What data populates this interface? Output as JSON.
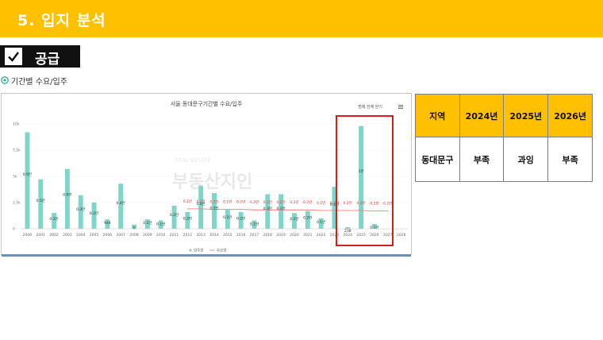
{
  "header": {
    "title": "5. 입지 분석",
    "accent": "#ffc000"
  },
  "section": {
    "label": "공급",
    "icon": "checkmark-icon"
  },
  "subheading": {
    "icon": "chart-circle-icon",
    "text": "기간별 수요/입주"
  },
  "chart_data": {
    "type": "bar",
    "title": "서울 동대문구기간별 수요/입주",
    "menu_label": "범례 전체 닫기",
    "watermark": "부동산지인",
    "categories": [
      "2000",
      "2001",
      "2002",
      "2003",
      "2004",
      "2005",
      "2006",
      "2007",
      "2008",
      "2009",
      "2010",
      "2011",
      "2012",
      "2013",
      "2014",
      "2015",
      "2016",
      "2017",
      "2018",
      "2019",
      "2020",
      "2021",
      "2022",
      "2023",
      "2024",
      "2025",
      "2026",
      "2027",
      "2028"
    ],
    "ylim": [
      0,
      10000
    ],
    "yticks": [
      "0",
      "2.5k",
      "5k",
      "7.5k",
      "10k"
    ],
    "bar_color": "#7dd6c8",
    "line_color": "#f28080",
    "series": [
      {
        "name": "입주량",
        "values": [
          9200,
          4700,
          1500,
          5700,
          3200,
          2500,
          900,
          4300,
          400,
          900,
          800,
          2200,
          1600,
          4100,
          3400,
          1800,
          1600,
          800,
          3300,
          3300,
          1500,
          1700,
          1000,
          4000,
          150,
          9800,
          450,
          0,
          0
        ],
        "labels": [
          "0.9만",
          "0.5만",
          "0.2만",
          "0.6만",
          "0.3만",
          "0.2만",
          "944",
          "0.4만",
          "0",
          "0.1만",
          "0.1만",
          "0.2만",
          "0.2만",
          "0.4만",
          "0.3만",
          "0.2만",
          "0.2만",
          "0.1만",
          "0.3만",
          "0.3만",
          "0.2만",
          "0.2만",
          "0.1만",
          "0.4만",
          "238",
          "1만",
          "0.1만",
          "",
          ""
        ]
      },
      {
        "name": "수요량",
        "values": [
          null,
          null,
          null,
          null,
          null,
          null,
          null,
          null,
          null,
          null,
          null,
          null,
          1900,
          1900,
          1850,
          1850,
          1850,
          1800,
          1800,
          1800,
          1800,
          1800,
          1750,
          1750,
          1750,
          1750,
          1700,
          1700,
          null
        ],
        "labels": [
          "",
          "",
          "",
          "",
          "",
          "",
          "",
          "",
          "",
          "",
          "",
          "",
          "0.2만",
          "0.2만",
          "0.2만",
          "0.2만",
          "0.2만",
          "0.2만",
          "0.2만",
          "0.2만",
          "0.2만",
          "0.2만",
          "0.2만",
          "0.2만",
          "0.2만",
          "0.2만",
          "0.2만",
          "0.2만",
          ""
        ]
      }
    ],
    "legend_placement": "bottom-center"
  },
  "verdict_table": {
    "headers": [
      "지역",
      "2024년",
      "2025년",
      "2026년"
    ],
    "rows": [
      [
        "동대문구",
        "부족",
        "과잉",
        "부족"
      ]
    ],
    "header_color": "#ffc000"
  },
  "highlight_color": "#d91c1c"
}
